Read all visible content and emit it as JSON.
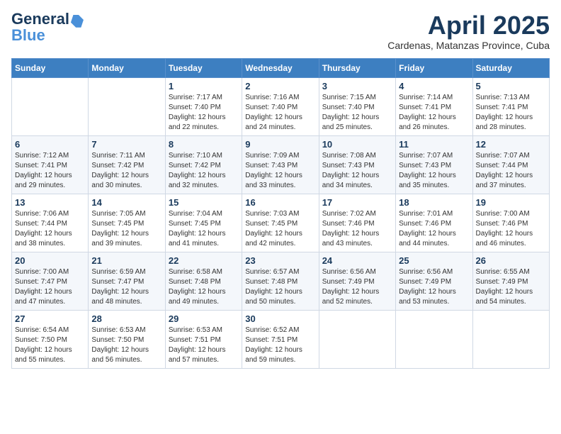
{
  "header": {
    "logo_general": "General",
    "logo_blue": "Blue",
    "month_year": "April 2025",
    "location": "Cardenas, Matanzas Province, Cuba"
  },
  "days_of_week": [
    "Sunday",
    "Monday",
    "Tuesday",
    "Wednesday",
    "Thursday",
    "Friday",
    "Saturday"
  ],
  "weeks": [
    [
      {
        "day": "",
        "detail": ""
      },
      {
        "day": "",
        "detail": ""
      },
      {
        "day": "1",
        "detail": "Sunrise: 7:17 AM\nSunset: 7:40 PM\nDaylight: 12 hours and 22 minutes."
      },
      {
        "day": "2",
        "detail": "Sunrise: 7:16 AM\nSunset: 7:40 PM\nDaylight: 12 hours and 24 minutes."
      },
      {
        "day": "3",
        "detail": "Sunrise: 7:15 AM\nSunset: 7:40 PM\nDaylight: 12 hours and 25 minutes."
      },
      {
        "day": "4",
        "detail": "Sunrise: 7:14 AM\nSunset: 7:41 PM\nDaylight: 12 hours and 26 minutes."
      },
      {
        "day": "5",
        "detail": "Sunrise: 7:13 AM\nSunset: 7:41 PM\nDaylight: 12 hours and 28 minutes."
      }
    ],
    [
      {
        "day": "6",
        "detail": "Sunrise: 7:12 AM\nSunset: 7:41 PM\nDaylight: 12 hours and 29 minutes."
      },
      {
        "day": "7",
        "detail": "Sunrise: 7:11 AM\nSunset: 7:42 PM\nDaylight: 12 hours and 30 minutes."
      },
      {
        "day": "8",
        "detail": "Sunrise: 7:10 AM\nSunset: 7:42 PM\nDaylight: 12 hours and 32 minutes."
      },
      {
        "day": "9",
        "detail": "Sunrise: 7:09 AM\nSunset: 7:43 PM\nDaylight: 12 hours and 33 minutes."
      },
      {
        "day": "10",
        "detail": "Sunrise: 7:08 AM\nSunset: 7:43 PM\nDaylight: 12 hours and 34 minutes."
      },
      {
        "day": "11",
        "detail": "Sunrise: 7:07 AM\nSunset: 7:43 PM\nDaylight: 12 hours and 35 minutes."
      },
      {
        "day": "12",
        "detail": "Sunrise: 7:07 AM\nSunset: 7:44 PM\nDaylight: 12 hours and 37 minutes."
      }
    ],
    [
      {
        "day": "13",
        "detail": "Sunrise: 7:06 AM\nSunset: 7:44 PM\nDaylight: 12 hours and 38 minutes."
      },
      {
        "day": "14",
        "detail": "Sunrise: 7:05 AM\nSunset: 7:45 PM\nDaylight: 12 hours and 39 minutes."
      },
      {
        "day": "15",
        "detail": "Sunrise: 7:04 AM\nSunset: 7:45 PM\nDaylight: 12 hours and 41 minutes."
      },
      {
        "day": "16",
        "detail": "Sunrise: 7:03 AM\nSunset: 7:45 PM\nDaylight: 12 hours and 42 minutes."
      },
      {
        "day": "17",
        "detail": "Sunrise: 7:02 AM\nSunset: 7:46 PM\nDaylight: 12 hours and 43 minutes."
      },
      {
        "day": "18",
        "detail": "Sunrise: 7:01 AM\nSunset: 7:46 PM\nDaylight: 12 hours and 44 minutes."
      },
      {
        "day": "19",
        "detail": "Sunrise: 7:00 AM\nSunset: 7:46 PM\nDaylight: 12 hours and 46 minutes."
      }
    ],
    [
      {
        "day": "20",
        "detail": "Sunrise: 7:00 AM\nSunset: 7:47 PM\nDaylight: 12 hours and 47 minutes."
      },
      {
        "day": "21",
        "detail": "Sunrise: 6:59 AM\nSunset: 7:47 PM\nDaylight: 12 hours and 48 minutes."
      },
      {
        "day": "22",
        "detail": "Sunrise: 6:58 AM\nSunset: 7:48 PM\nDaylight: 12 hours and 49 minutes."
      },
      {
        "day": "23",
        "detail": "Sunrise: 6:57 AM\nSunset: 7:48 PM\nDaylight: 12 hours and 50 minutes."
      },
      {
        "day": "24",
        "detail": "Sunrise: 6:56 AM\nSunset: 7:49 PM\nDaylight: 12 hours and 52 minutes."
      },
      {
        "day": "25",
        "detail": "Sunrise: 6:56 AM\nSunset: 7:49 PM\nDaylight: 12 hours and 53 minutes."
      },
      {
        "day": "26",
        "detail": "Sunrise: 6:55 AM\nSunset: 7:49 PM\nDaylight: 12 hours and 54 minutes."
      }
    ],
    [
      {
        "day": "27",
        "detail": "Sunrise: 6:54 AM\nSunset: 7:50 PM\nDaylight: 12 hours and 55 minutes."
      },
      {
        "day": "28",
        "detail": "Sunrise: 6:53 AM\nSunset: 7:50 PM\nDaylight: 12 hours and 56 minutes."
      },
      {
        "day": "29",
        "detail": "Sunrise: 6:53 AM\nSunset: 7:51 PM\nDaylight: 12 hours and 57 minutes."
      },
      {
        "day": "30",
        "detail": "Sunrise: 6:52 AM\nSunset: 7:51 PM\nDaylight: 12 hours and 59 minutes."
      },
      {
        "day": "",
        "detail": ""
      },
      {
        "day": "",
        "detail": ""
      },
      {
        "day": "",
        "detail": ""
      }
    ]
  ]
}
